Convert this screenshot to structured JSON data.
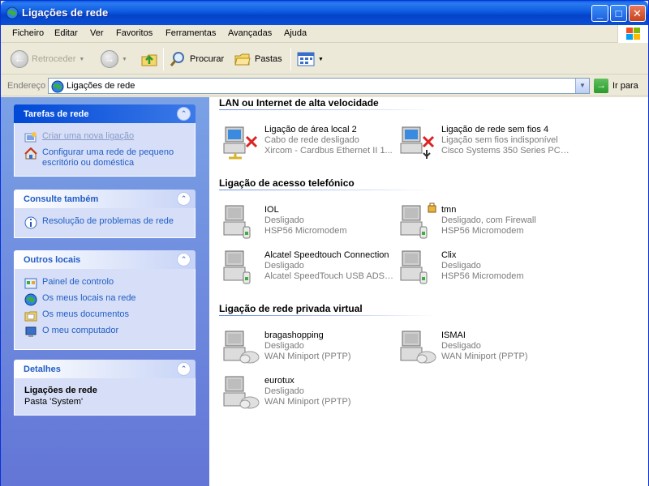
{
  "window": {
    "title": "Ligações de rede",
    "buttons": {
      "minimize": "_",
      "maximize": "□",
      "close": "✕"
    }
  },
  "menu": [
    "Ficheiro",
    "Editar",
    "Ver",
    "Favoritos",
    "Ferramentas",
    "Avançadas",
    "Ajuda"
  ],
  "toolbar": {
    "back": "Retroceder",
    "search": "Procurar",
    "folders": "Pastas"
  },
  "address": {
    "label": "Endereço",
    "value": "Ligações de rede",
    "go": "Ir para"
  },
  "sidebar": {
    "panels": [
      {
        "title": "Tarefas de rede",
        "items": [
          {
            "label": "Criar uma nova ligação",
            "icon": "new-connection-icon"
          },
          {
            "label": "Configurar uma rede de pequeno escritório ou doméstica",
            "icon": "home-network-icon"
          }
        ]
      },
      {
        "title": "Consulte também",
        "items": [
          {
            "label": "Resolução de problemas de rede",
            "icon": "info-icon"
          }
        ]
      },
      {
        "title": "Outros locais",
        "items": [
          {
            "label": "Painel de controlo",
            "icon": "control-panel-icon"
          },
          {
            "label": "Os meus locais na rede",
            "icon": "network-places-icon"
          },
          {
            "label": "Os meus documentos",
            "icon": "documents-folder-icon"
          },
          {
            "label": "O meu computador",
            "icon": "computer-icon"
          }
        ]
      },
      {
        "title": "Detalhes",
        "name": "Ligações de rede",
        "description": "Pasta 'System'"
      }
    ]
  },
  "groups": [
    {
      "title": "LAN ou Internet de alta velocidade",
      "items": [
        {
          "name": "Ligação de área local 2",
          "status": "Cabo de rede desligado",
          "device": "Xircom - Cardbus Ethernet II 1...",
          "icon": "lan-disconnected-icon"
        },
        {
          "name": "Ligação de rede sem fios 4",
          "status": "Ligação sem fios indisponível",
          "device": "Cisco Systems 350 Series PCM...",
          "icon": "wireless-disconnected-icon"
        }
      ]
    },
    {
      "title": "Ligação de acesso telefónico",
      "items": [
        {
          "name": "IOL",
          "status": "Desligado",
          "device": "HSP56 Micromodem",
          "icon": "dialup-icon"
        },
        {
          "name": "tmn",
          "status": "Desligado, com Firewall",
          "device": "HSP56 Micromodem",
          "icon": "dialup-firewall-icon"
        },
        {
          "name": "Alcatel Speedtouch Connection",
          "status": "Desligado",
          "device": "Alcatel SpeedTouch USB ADSL...",
          "icon": "dialup-icon"
        },
        {
          "name": "Clix",
          "status": "Desligado",
          "device": "HSP56 Micromodem",
          "icon": "dialup-icon"
        }
      ]
    },
    {
      "title": "Ligação de rede privada virtual",
      "items": [
        {
          "name": "bragashopping",
          "status": "Desligado",
          "device": "WAN Miniport (PPTP)",
          "icon": "vpn-icon"
        },
        {
          "name": "ISMAI",
          "status": "Desligado",
          "device": "WAN Miniport (PPTP)",
          "icon": "vpn-icon"
        },
        {
          "name": "eurotux",
          "status": "Desligado",
          "device": "WAN Miniport (PPTP)",
          "icon": "vpn-icon"
        }
      ]
    }
  ],
  "colors": {
    "title_bar": "#0a4fd6",
    "task_pane": "#6f8ce0",
    "link": "#215dc6"
  }
}
